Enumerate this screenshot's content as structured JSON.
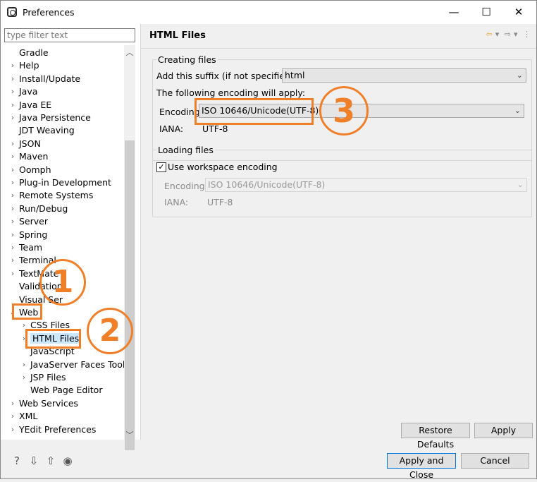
{
  "window": {
    "title": "Preferences",
    "minimize": "—",
    "maximize": "☐",
    "close": "✕"
  },
  "filter": {
    "placeholder": "type filter text"
  },
  "tree": {
    "items": [
      {
        "label": "Gradle",
        "chev": ""
      },
      {
        "label": "Help",
        "chev": "›"
      },
      {
        "label": "Install/Update",
        "chev": "›"
      },
      {
        "label": "Java",
        "chev": "›"
      },
      {
        "label": "Java EE",
        "chev": "›"
      },
      {
        "label": "Java Persistence",
        "chev": "›"
      },
      {
        "label": "JDT Weaving",
        "chev": ""
      },
      {
        "label": "JSON",
        "chev": "›"
      },
      {
        "label": "Maven",
        "chev": "›"
      },
      {
        "label": "Oomph",
        "chev": "›"
      },
      {
        "label": "Plug-in Development",
        "chev": "›"
      },
      {
        "label": "Remote Systems",
        "chev": "›"
      },
      {
        "label": "Run/Debug",
        "chev": "›"
      },
      {
        "label": "Server",
        "chev": "›"
      },
      {
        "label": "Spring",
        "chev": "›"
      },
      {
        "label": "Team",
        "chev": "›"
      },
      {
        "label": "Terminal",
        "chev": "›"
      },
      {
        "label": "TextMate",
        "chev": "›"
      },
      {
        "label": "Validation",
        "chev": ""
      },
      {
        "label": "Visual Ser",
        "chev": ""
      },
      {
        "label": "Web",
        "chev": "⌄"
      },
      {
        "label": "CSS Files",
        "chev": "›"
      },
      {
        "label": "HTML Files",
        "chev": "›"
      },
      {
        "label": "JavaScript",
        "chev": ""
      },
      {
        "label": "JavaServer Faces Tools",
        "chev": "›"
      },
      {
        "label": "JSP Files",
        "chev": "›"
      },
      {
        "label": "Web Page Editor",
        "chev": ""
      },
      {
        "label": "Web Services",
        "chev": "›"
      },
      {
        "label": "XML",
        "chev": "›"
      },
      {
        "label": "YEdit Preferences",
        "chev": "›"
      }
    ]
  },
  "page": {
    "title": "HTML Files",
    "creating": {
      "group_label": "Creating files",
      "suffix_label": "Add this suffix (if not specified):",
      "suffix_value": "html",
      "encoding_apply": "The following encoding will apply:",
      "encoding_label": "Encoding:",
      "encoding_value": "ISO 10646/Unicode(UTF-8)",
      "iana_label": "IANA:",
      "iana_value": "UTF-8"
    },
    "loading": {
      "group_label": "Loading files",
      "workspace_label": "Use workspace encoding",
      "workspace_checked": "✓",
      "encoding_label": "Encoding:",
      "encoding_value": "ISO 10646/Unicode(UTF-8)",
      "iana_label": "IANA:",
      "iana_value": "UTF-8"
    },
    "restore_defaults": "Restore Defaults",
    "apply": "Apply"
  },
  "footer": {
    "apply_close": "Apply and Close",
    "cancel": "Cancel"
  },
  "annotations": {
    "one": "1",
    "two": "2",
    "three": "3",
    "color": "#f07f2a"
  }
}
